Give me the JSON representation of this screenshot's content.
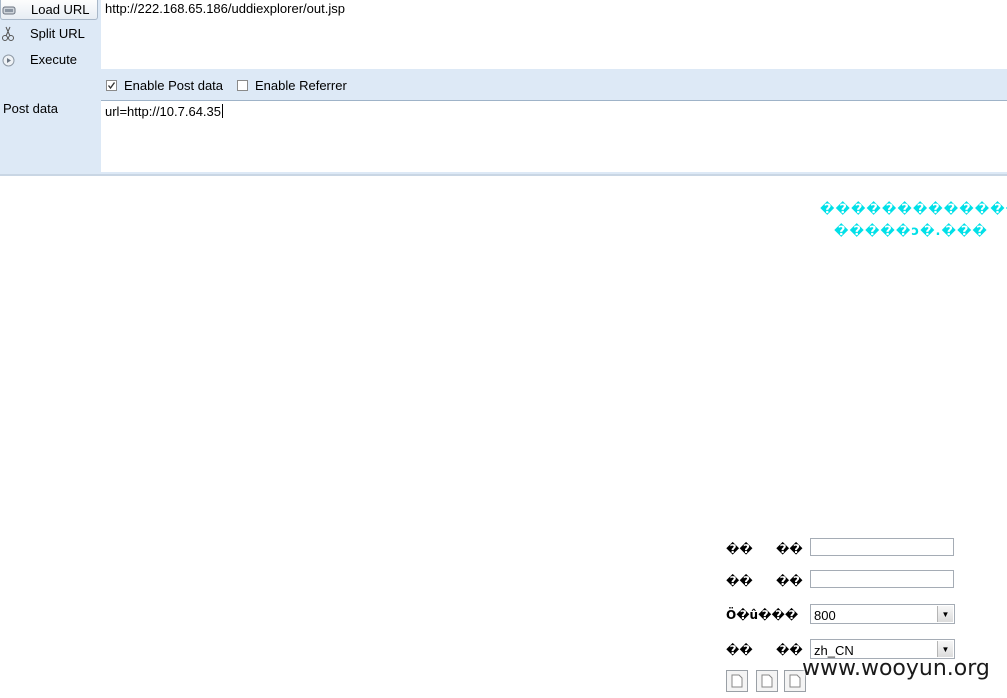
{
  "hackbar": {
    "buttons": {
      "load_url": "Load URL",
      "split_url": "Split URL",
      "execute": "Execute"
    },
    "url_value": "http://222.168.65.186/uddiexplorer/out.jsp",
    "options": {
      "enable_post": "Enable Post data",
      "enable_post_checked": true,
      "enable_referrer": "Enable Referrer",
      "enable_referrer_checked": false
    },
    "post_label": "Post data",
    "post_value": "url=http://10.7.64.35"
  },
  "page": {
    "garbled_line_1": "��������������",
    "garbled_line_2": "�����ɔ�.���",
    "form": {
      "row1_label_a": "��",
      "row1_label_b": "��",
      "row2_label_a": "��",
      "row2_label_b": "��",
      "row3_label": "Ö�û���",
      "row3_value": "800",
      "row4_label_a": "��",
      "row4_label_b": "��",
      "row4_value": "zh_CN"
    }
  },
  "watermark": "www.wooyun.org"
}
